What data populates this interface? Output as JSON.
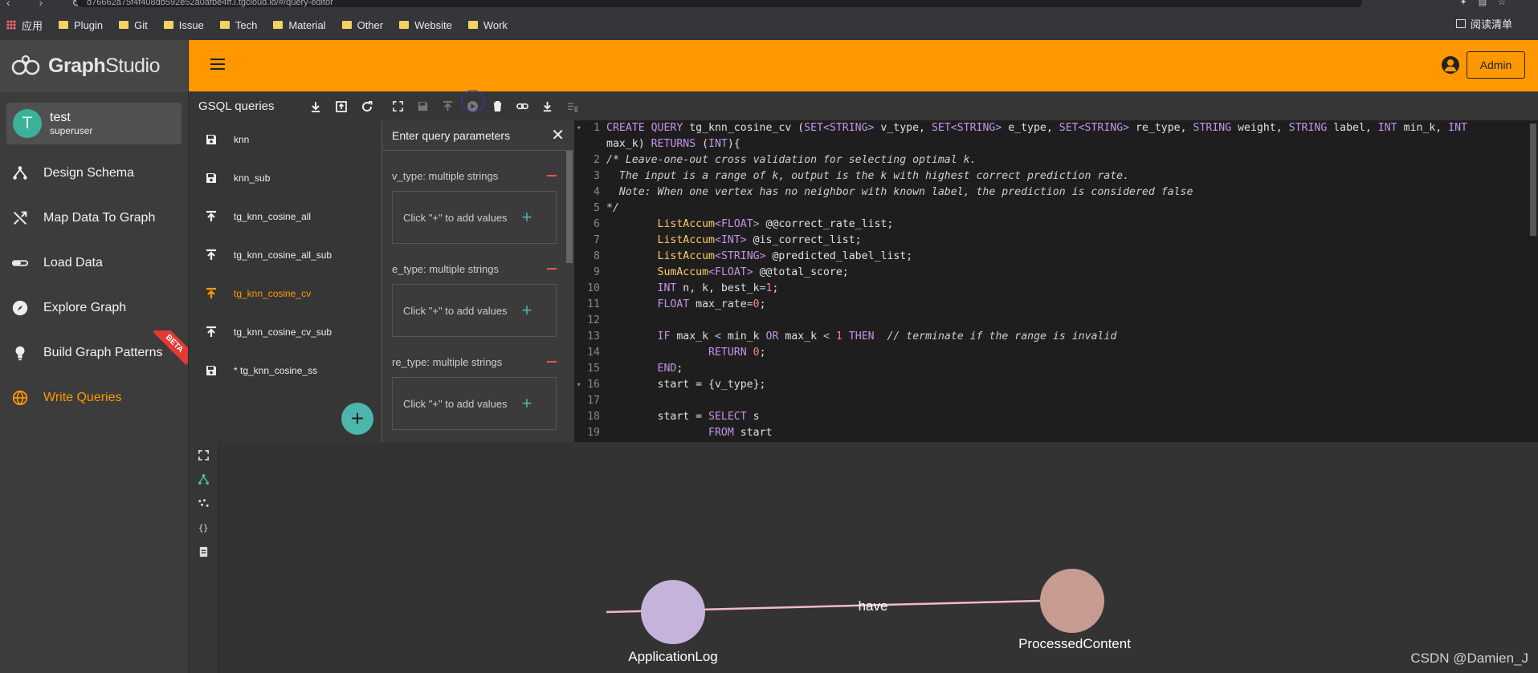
{
  "browser": {
    "url": "d76662a75f4f408db592e52a0afbe4ff.i.tgcloud.io/#/query-editor",
    "bookmarks": [
      "应用",
      "Plugin",
      "Git",
      "Issue",
      "Tech",
      "Material",
      "Other",
      "Website",
      "Work"
    ],
    "reading_list": "阅读清单"
  },
  "app": {
    "logo_bold": "Graph",
    "logo_light": "Studio",
    "admin_label": "Admin"
  },
  "user": {
    "initial": "T",
    "name": "test",
    "role": "superuser"
  },
  "nav": {
    "items": [
      {
        "label": "Design Schema",
        "icon": "schema-icon"
      },
      {
        "label": "Map Data To Graph",
        "icon": "shuffle-icon"
      },
      {
        "label": "Load Data",
        "icon": "progress-icon"
      },
      {
        "label": "Explore Graph",
        "icon": "compass-icon"
      },
      {
        "label": "Build Graph Patterns",
        "icon": "lightbulb-icon",
        "badge": "BETA"
      },
      {
        "label": "Write Queries",
        "icon": "globe-icon",
        "active": true
      }
    ]
  },
  "queries": {
    "title": "GSQL queries",
    "items": [
      {
        "name": "knn",
        "icon": "save-icon"
      },
      {
        "name": "knn_sub",
        "icon": "save-icon"
      },
      {
        "name": "tg_knn_cosine_all",
        "icon": "publish-icon"
      },
      {
        "name": "tg_knn_cosine_all_sub",
        "icon": "publish-icon"
      },
      {
        "name": "tg_knn_cosine_cv",
        "icon": "publish-icon",
        "active": true
      },
      {
        "name": "tg_knn_cosine_cv_sub",
        "icon": "publish-icon"
      },
      {
        "name": "* tg_knn_cosine_ss",
        "icon": "save-icon"
      }
    ],
    "add_label": "+"
  },
  "params": {
    "title": "Enter query parameters",
    "items": [
      {
        "label": "v_type: multiple strings",
        "hint": "Click \"+\" to add values"
      },
      {
        "label": "e_type: multiple strings",
        "hint": "Click \"+\" to add values"
      },
      {
        "label": "re_type: multiple strings",
        "hint": "Click \"+\" to add values"
      }
    ]
  },
  "graph": {
    "nodes": [
      {
        "label": "ApplicationLog",
        "color": "#c5b3dc"
      },
      {
        "label": "ProcessedContent",
        "color": "#c89b92"
      }
    ],
    "edge_label": "have",
    "edge_color": "#f1b9c9"
  },
  "watermark": "CSDN @Damien_J"
}
